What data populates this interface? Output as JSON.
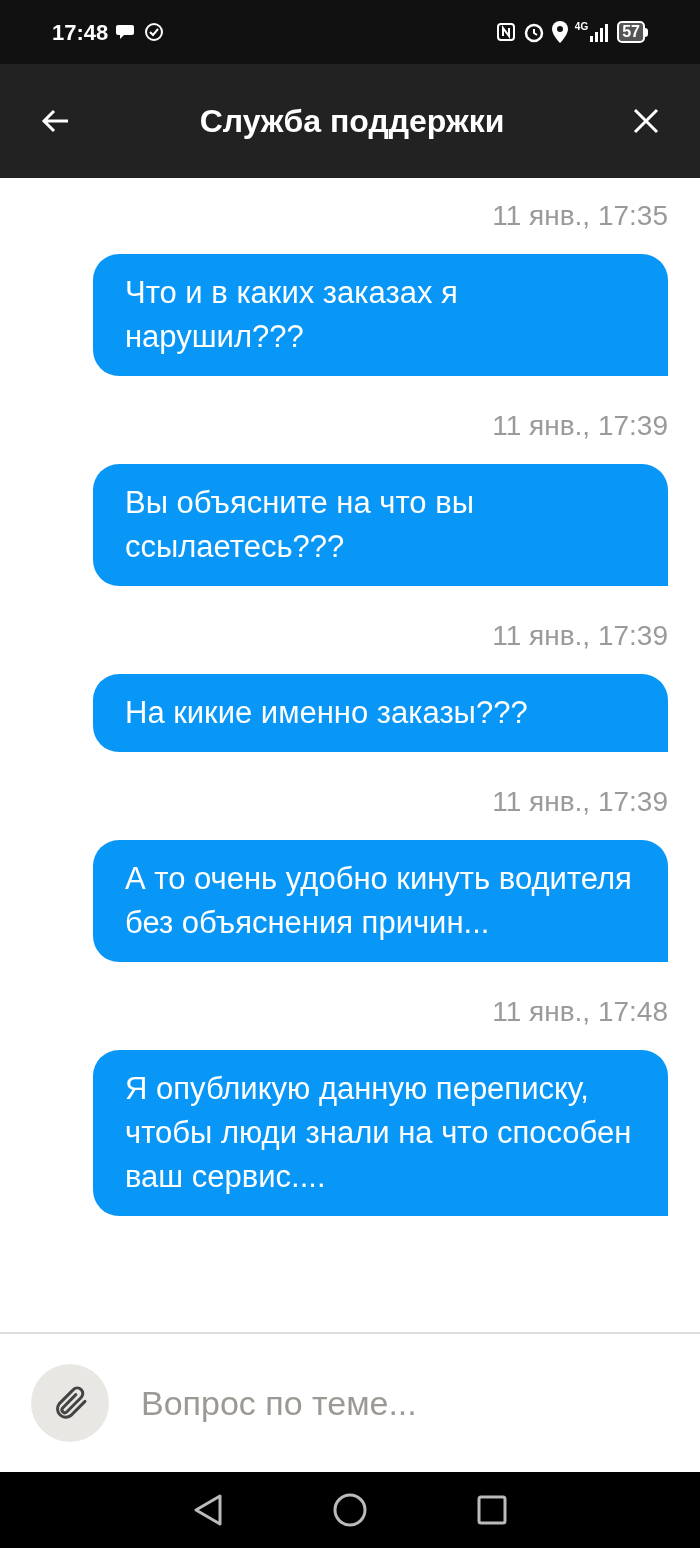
{
  "status_bar": {
    "time": "17:48",
    "network": "4G",
    "battery": "57"
  },
  "header": {
    "title": "Служба поддержки"
  },
  "messages": [
    {
      "time": "11 янв., 17:35",
      "text": "Что и в каких заказах я нарушил???"
    },
    {
      "time": "11 янв., 17:39",
      "text": "Вы объясните на что вы ссылаетесь???"
    },
    {
      "time": "11 янв., 17:39",
      "text": "На кикие именно заказы???"
    },
    {
      "time": "11 янв., 17:39",
      "text": "А то очень удобно кинуть водителя без объяснения причин..."
    },
    {
      "time": "11 янв., 17:48",
      "text": "Я опубликую данную переписку, чтобы люди знали на что способен ваш сервис...."
    }
  ],
  "composer": {
    "placeholder": "Вопрос по теме..."
  }
}
